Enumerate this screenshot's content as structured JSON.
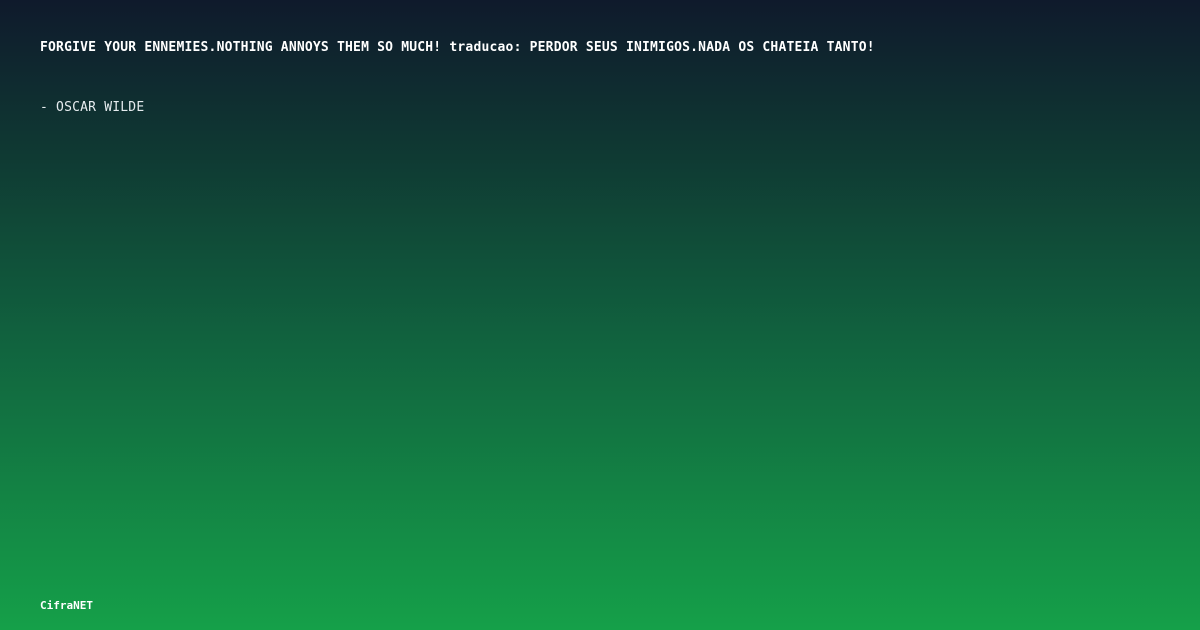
{
  "quote": {
    "text": "FORGIVE YOUR ENNEMIES.NOTHING ANNOYS THEM SO MUCH! traducao: PERDOR SEUS INIMIGOS.NADA OS CHATEIA TANTO!",
    "author": "- OSCAR WILDE"
  },
  "footer": {
    "brand": "CifraNET"
  },
  "colors": {
    "gradient_top": "#0f1a2c",
    "gradient_bottom": "#15a049",
    "text": "#ffffff"
  }
}
